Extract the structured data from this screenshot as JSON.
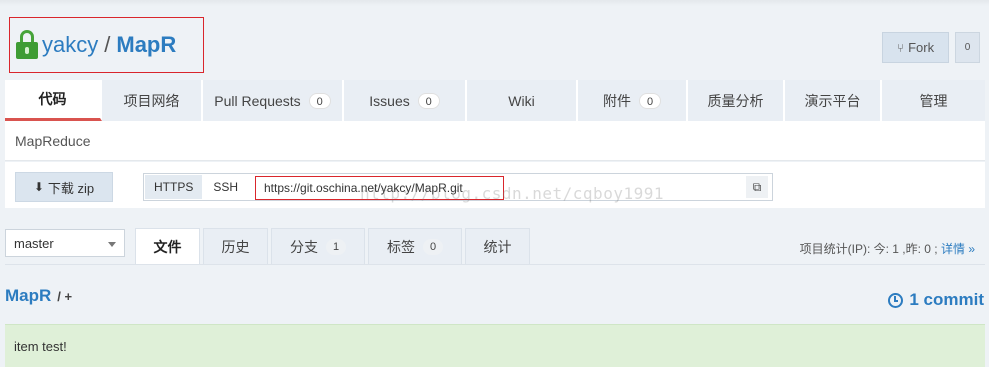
{
  "repo": {
    "owner": "yakcy",
    "separator": "/",
    "name": "MapR"
  },
  "fork": {
    "label": "Fork",
    "count": "0"
  },
  "nav": {
    "tabs": [
      {
        "label": "代码"
      },
      {
        "label": "项目网络"
      },
      {
        "label": "Pull Requests",
        "badge": "0"
      },
      {
        "label": "Issues",
        "badge": "0"
      },
      {
        "label": "Wiki"
      },
      {
        "label": "附件",
        "badge": "0"
      },
      {
        "label": "质量分析"
      },
      {
        "label": "演示平台"
      },
      {
        "label": "管理"
      }
    ]
  },
  "description": "MapReduce",
  "clone": {
    "download_label": "下载 zip",
    "protocols": [
      "HTTPS",
      "SSH"
    ],
    "url": "https://git.oschina.net/yakcy/MapR.git"
  },
  "watermark": "http://blog.csdn.net/cqboy1991",
  "branch": {
    "selected": "master"
  },
  "code_tabs": [
    {
      "label": "文件"
    },
    {
      "label": "历史"
    },
    {
      "label": "分支",
      "badge": "1"
    },
    {
      "label": "标签",
      "badge": "0"
    },
    {
      "label": "统计"
    }
  ],
  "stats": {
    "text": "项目统计(IP): 今: 1 ,昨: 0 ;",
    "link": "详情 »"
  },
  "path": {
    "repo": "MapR",
    "sep": "/ +"
  },
  "commits": {
    "label": "1 commit"
  },
  "last_commit": {
    "message": "item test!"
  },
  "colors": {
    "link": "#2c7cc0",
    "active_tab_border": "#d9534f",
    "commit_bg": "#dff0d8",
    "highlight_box": "#d9262c"
  }
}
